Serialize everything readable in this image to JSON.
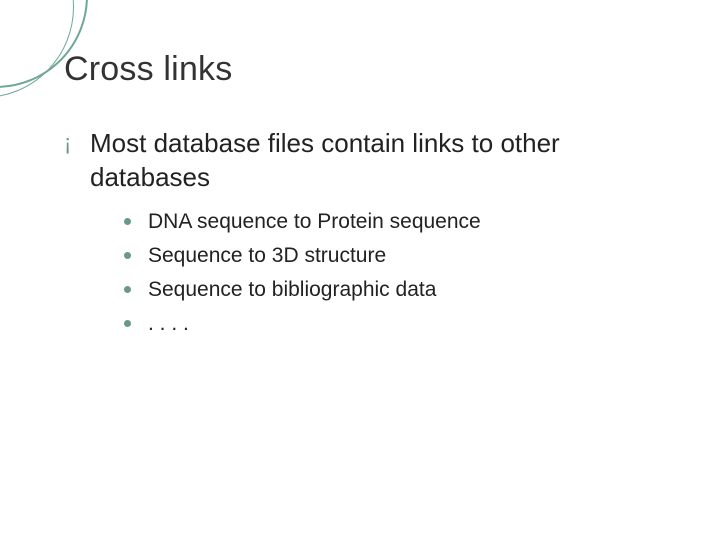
{
  "title": "Cross links",
  "main": "Most database files contain links to other databases",
  "sub": [
    "DNA sequence to Protein sequence",
    "Sequence to 3D structure",
    "Sequence to bibliographic data",
    ". . . ."
  ]
}
